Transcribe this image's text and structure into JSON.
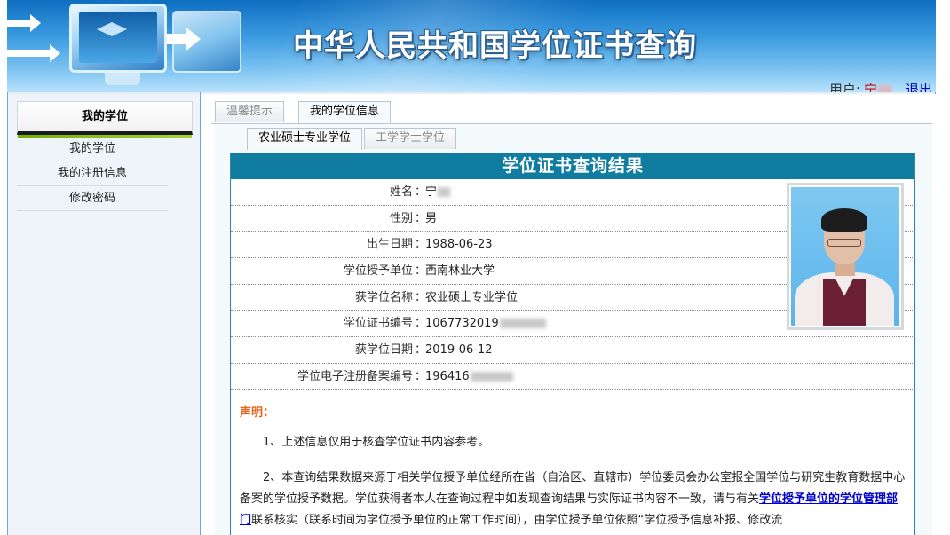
{
  "header": {
    "site_title": "中华人民共和国学位证书查询",
    "user_label": "用户:",
    "user_name": "宁",
    "logout_label": "退出"
  },
  "sidebar": {
    "heading": "我的学位",
    "items": [
      {
        "label": "我的学位"
      },
      {
        "label": "我的注册信息"
      },
      {
        "label": "修改密码"
      }
    ]
  },
  "main": {
    "tabs": [
      {
        "label": "温馨提示",
        "active": false
      },
      {
        "label": "我的学位信息",
        "active": true
      }
    ],
    "subtabs": [
      {
        "label": "农业硕士专业学位",
        "active": true
      },
      {
        "label": "工学学士学位",
        "active": false
      }
    ],
    "result_title": "学位证书查询结果",
    "fields": [
      {
        "label": "姓名",
        "value": "宁"
      },
      {
        "label": "性别",
        "value": "男"
      },
      {
        "label": "出生日期",
        "value": "1988-06-23"
      },
      {
        "label": "学位授予单位",
        "value": "西南林业大学"
      },
      {
        "label": "获学位名称",
        "value": "农业硕士专业学位"
      },
      {
        "label": "学位证书编号",
        "value": "1067732019"
      },
      {
        "label": "获学位日期",
        "value": "2019-06-12"
      },
      {
        "label": "学位电子注册备案编号",
        "value": "196416"
      }
    ],
    "colon": "：",
    "notice": {
      "title": "声明：",
      "p1": "1、上述信息仅用于核查学位证书内容参考。",
      "p2_a": "2、本查询结果数据来源于相关学位授予单位经所在省（自治区、直辖市）学位委员会办公室报全国学位与研究生教育数据中心备案的学位授予数据。学位获得者本人在查询过程中如发现查询结果与实际证书内容不一致，请与有关",
      "p2_link": "学位授予单位的学位管理部门",
      "p2_b": "联系核实（联系时间为学位授予单位的正常工作时间），由学位授予单位依照“学位授予信息补报、修改流"
    }
  },
  "colors": {
    "title_bar": "#107da0",
    "notice_title": "#e8641a",
    "link": "#0000cc",
    "user_name": "#d40000"
  }
}
